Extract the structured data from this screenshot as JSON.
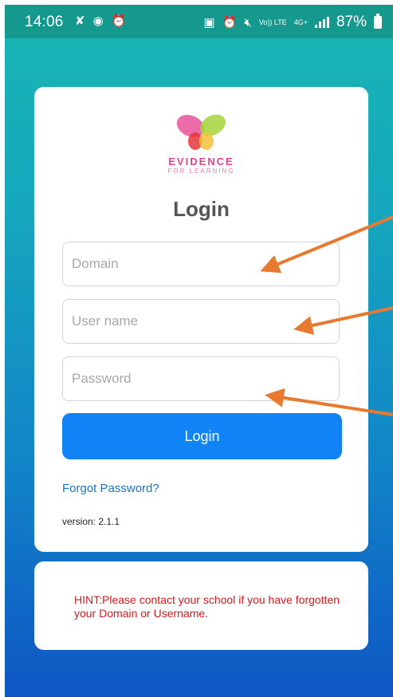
{
  "status_bar": {
    "time": "14:06",
    "network_volte": "Vo)) LTE",
    "network_4g": "4G+",
    "battery": "87%"
  },
  "logo": {
    "title": "EVIDENCE",
    "subtitle": "FOR LEARNING",
    "colors": {
      "pink": "#e9519c",
      "red": "#e8363a",
      "green": "#a4d33a",
      "yellow": "#f2c23b"
    }
  },
  "login": {
    "title": "Login",
    "domain_placeholder": "Domain",
    "username_placeholder": "User name",
    "password_placeholder": "Password",
    "button_label": "Login",
    "forgot_password": "Forgot Password?",
    "version": "version: 2.1.1"
  },
  "hint": {
    "text": "HINT:Please contact your school if you have forgotten your Domain or Username."
  },
  "colors": {
    "accent": "#1283f6",
    "link": "#1a76c6",
    "hint": "#d21a1a",
    "annotation_arrow": "#e77a2e",
    "status_bar": "#15998f"
  }
}
